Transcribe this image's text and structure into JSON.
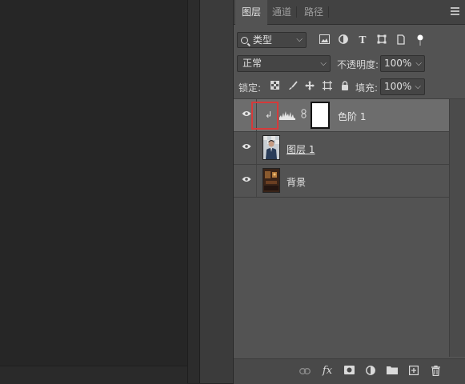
{
  "tabs": [
    {
      "label": "图层",
      "active": true
    },
    {
      "label": "通道",
      "active": false
    },
    {
      "label": "路径",
      "active": false
    }
  ],
  "filter": {
    "kind_label": "类型",
    "icons": [
      "pixel-filter-icon",
      "adjustment-filter-icon",
      "type-filter-icon",
      "shape-filter-icon",
      "smart-object-filter-icon",
      "filter-toggle-icon"
    ]
  },
  "blend": {
    "mode": "正常",
    "opacity_label": "不透明度:",
    "opacity_value": "100%"
  },
  "lock": {
    "label": "锁定:",
    "icons": [
      "lock-transparent-pixels-icon",
      "lock-image-pixels-icon",
      "lock-position-icon",
      "lock-artboard-icon",
      "lock-all-icon"
    ],
    "fill_label": "填充:",
    "fill_value": "100%"
  },
  "layers": [
    {
      "name": "色阶 1",
      "type": "adjustment",
      "visible": true,
      "selected": true,
      "clipped": true
    },
    {
      "name": "图层 1",
      "type": "pixel",
      "visible": true,
      "selected": false
    },
    {
      "name": "背景",
      "type": "background",
      "visible": true,
      "selected": false
    }
  ],
  "footer_icons": [
    "link-layers-icon",
    "fx-icon",
    "add-mask-icon",
    "new-fill-adjustment-icon",
    "new-group-icon",
    "new-layer-icon",
    "delete-layer-icon"
  ],
  "colors": {
    "panel": "#535353",
    "selected_row": "#6d6d6d",
    "highlight": "#d63a3a",
    "canvas": "#262626"
  }
}
